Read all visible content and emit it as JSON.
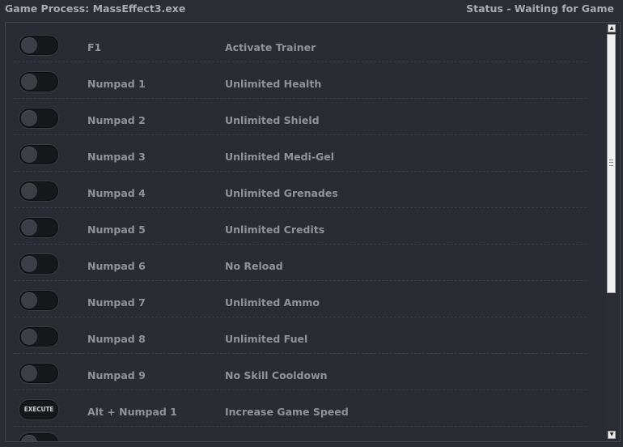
{
  "header": {
    "game_process": "Game Process: MassEffect3.exe",
    "status": "Status - Waiting for Game"
  },
  "rows": [
    {
      "hotkey": "F1",
      "label": "Activate Trainer",
      "control": "toggle",
      "state": "off"
    },
    {
      "hotkey": "Numpad 1",
      "label": "Unlimited Health",
      "control": "toggle",
      "state": "off"
    },
    {
      "hotkey": "Numpad 2",
      "label": "Unlimited Shield",
      "control": "toggle",
      "state": "off"
    },
    {
      "hotkey": "Numpad 3",
      "label": "Unlimited Medi-Gel",
      "control": "toggle",
      "state": "off"
    },
    {
      "hotkey": "Numpad 4",
      "label": "Unlimited Grenades",
      "control": "toggle",
      "state": "off"
    },
    {
      "hotkey": "Numpad 5",
      "label": "Unlimited Credits",
      "control": "toggle",
      "state": "off"
    },
    {
      "hotkey": "Numpad 6",
      "label": "No Reload",
      "control": "toggle",
      "state": "off"
    },
    {
      "hotkey": "Numpad 7",
      "label": "Unlimited Ammo",
      "control": "toggle",
      "state": "off"
    },
    {
      "hotkey": "Numpad 8",
      "label": "Unlimited Fuel",
      "control": "toggle",
      "state": "off"
    },
    {
      "hotkey": "Numpad 9",
      "label": "No Skill Cooldown",
      "control": "toggle",
      "state": "off"
    },
    {
      "hotkey": "Alt + Numpad 1",
      "label": "Increase Game Speed",
      "control": "execute",
      "button_label": "EXECUTE"
    }
  ],
  "colors": {
    "background": "#2a2d33",
    "text": "#8f949b",
    "header_text": "#a9adb3"
  }
}
